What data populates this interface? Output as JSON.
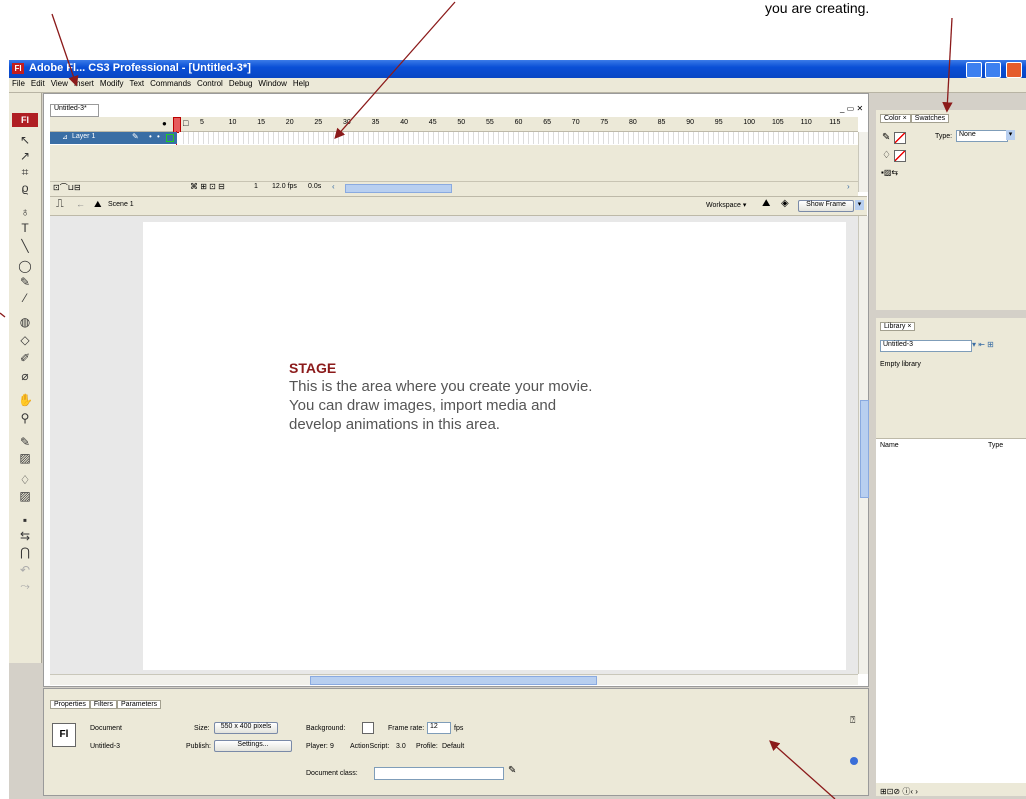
{
  "annotation": {
    "top_right_text": "you are creating.",
    "stage_heading": "STAGE",
    "stage_body": "This is the area where you create your movie.  You can draw images, import media and develop animations in this area."
  },
  "window": {
    "title": "Adobe Fl... CS3 Professional - [Untitled-3*]",
    "menu": [
      "File",
      "Edit",
      "View",
      "Insert",
      "Modify",
      "Text",
      "Commands",
      "Control",
      "Debug",
      "Window",
      "Help"
    ]
  },
  "timeline": {
    "doc_tab": "Untitled-3*",
    "frame_numbers": [
      "5",
      "10",
      "15",
      "20",
      "25",
      "30",
      "35",
      "40",
      "45",
      "50",
      "55",
      "60",
      "65",
      "70",
      "75",
      "80",
      "85",
      "90",
      "95",
      "100",
      "105",
      "110",
      "115"
    ],
    "layer_name": "Layer 1",
    "status": {
      "frame": "1",
      "fps": "12.0 fps",
      "time": "0.0s"
    }
  },
  "editbar": {
    "scene": "Scene 1",
    "workspace": "Workspace",
    "zoom": "Show Frame"
  },
  "properties": {
    "tabs": [
      "Properties",
      "Filters",
      "Parameters"
    ],
    "doc_type": "Document",
    "doc_name": "Untitled-3",
    "size_label": "Size:",
    "size_value": "550 x 400 pixels",
    "publish_label": "Publish:",
    "settings_button": "Settings...",
    "background_label": "Background:",
    "framerate_label": "Frame rate:",
    "framerate_value": "12",
    "fps": "fps",
    "player_label": "Player:",
    "player_value": "9",
    "actionscript_label": "ActionScript:",
    "actionscript_value": "3.0",
    "profile_label": "Profile:",
    "profile_value": "Default",
    "docclass_label": "Document class:"
  },
  "color_panel": {
    "tabs": [
      "Color",
      "Swatches"
    ],
    "type_label": "Type:",
    "type_value": "None"
  },
  "library": {
    "tab": "Library",
    "doc": "Untitled-3",
    "empty": "Empty library",
    "col_name": "Name",
    "col_type": "Type"
  },
  "colors": {
    "annotation_arrow": "#8b1a1a",
    "stage_heading": "#8b1a1a",
    "titlebar": "#0a4fd6"
  }
}
